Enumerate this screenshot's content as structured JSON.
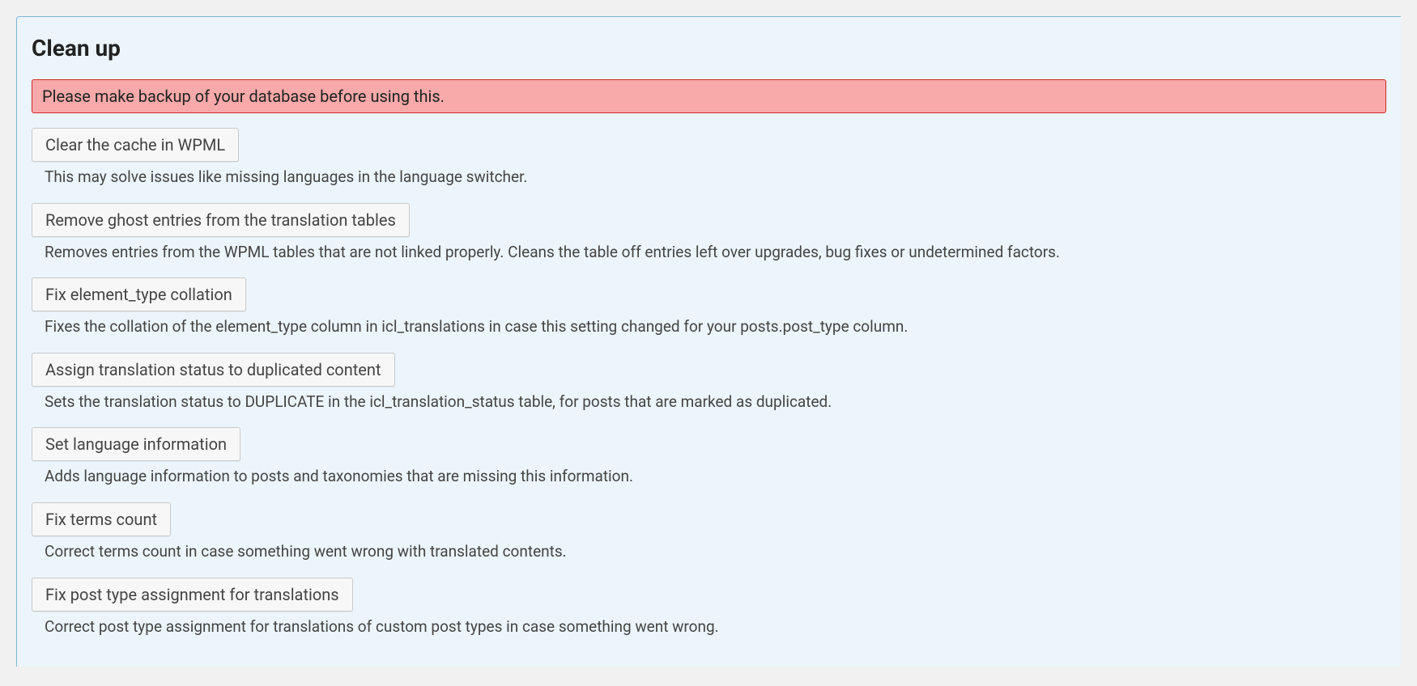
{
  "panel": {
    "title": "Clean up",
    "warning": "Please make backup of your database before using this.",
    "actions": [
      {
        "label": "Clear the cache in WPML",
        "desc": "This may solve issues like missing languages in the language switcher."
      },
      {
        "label": "Remove ghost entries from the translation tables",
        "desc": "Removes entries from the WPML tables that are not linked properly. Cleans the table off entries left over upgrades, bug fixes or undetermined factors."
      },
      {
        "label": "Fix element_type collation",
        "desc": "Fixes the collation of the element_type column in icl_translations in case this setting changed for your posts.post_type column."
      },
      {
        "label": "Assign translation status to duplicated content",
        "desc": "Sets the translation status to DUPLICATE in the icl_translation_status table, for posts that are marked as duplicated."
      },
      {
        "label": "Set language information",
        "desc": "Adds language information to posts and taxonomies that are missing this information."
      },
      {
        "label": "Fix terms count",
        "desc": "Correct terms count in case something went wrong with translated contents."
      },
      {
        "label": "Fix post type assignment for translations",
        "desc": "Correct post type assignment for translations of custom post types in case something went wrong."
      }
    ]
  }
}
